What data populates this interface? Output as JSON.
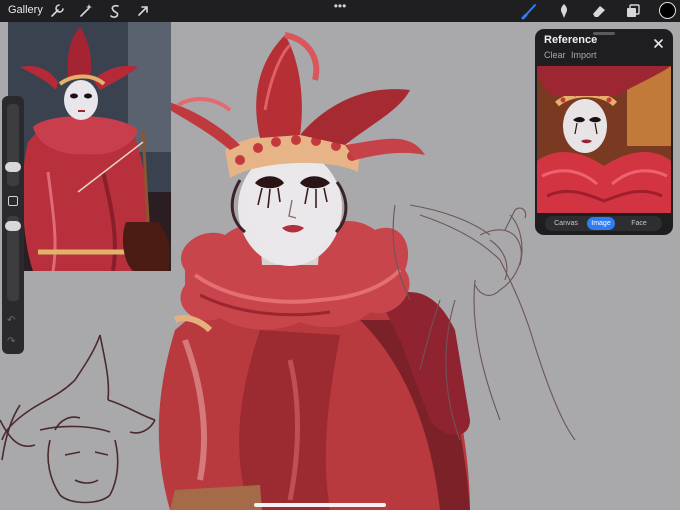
{
  "toolbar": {
    "gallery_label": "Gallery",
    "icons": [
      "wrench-icon",
      "magic-wand-icon",
      "selection-icon",
      "transform-arrow-icon",
      "brush-icon",
      "smudge-icon",
      "eraser-icon",
      "layers-icon"
    ],
    "more_label": "•••",
    "active_color": "#000000",
    "accent": "#2f7df6"
  },
  "sidebar": {
    "undo_label": "↶",
    "redo_label": "↷"
  },
  "reference_panel": {
    "title": "Reference",
    "clear_label": "Clear",
    "import_label": "Import",
    "tabs": [
      {
        "label": "Canvas",
        "active": false
      },
      {
        "label": "Image",
        "active": true
      },
      {
        "label": "Face",
        "active": false
      }
    ]
  }
}
